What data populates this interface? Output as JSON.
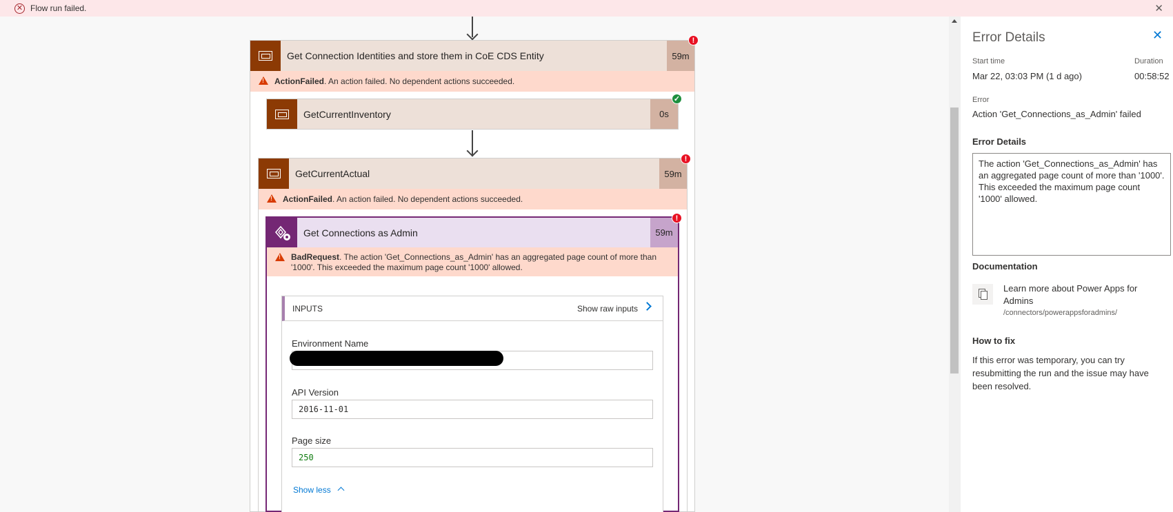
{
  "banner": {
    "message": "Flow run failed."
  },
  "flow": {
    "scope1": {
      "title": "Get Connection Identities and store them in CoE CDS Entity",
      "duration": "59m",
      "error_type": "ActionFailed",
      "error_msg": ". An action failed. No dependent actions succeeded."
    },
    "step_inventory": {
      "title": "GetCurrentInventory",
      "duration": "0s"
    },
    "scope2": {
      "title": "GetCurrentActual",
      "duration": "59m",
      "error_type": "ActionFailed",
      "error_msg": ". An action failed. No dependent actions succeeded."
    },
    "admin_action": {
      "title": "Get Connections as Admin",
      "duration": "59m",
      "error_type": "BadRequest",
      "error_line1": ". The action 'Get_Connections_as_Admin' has an aggregated page count of more than",
      "error_line2": "'1000'. This exceeded the maximum page count '1000' allowed.",
      "inputs_label": "INPUTS",
      "show_raw": "Show raw inputs",
      "fields": [
        {
          "label": "Environment Name",
          "value": ""
        },
        {
          "label": "API Version",
          "value": "2016-11-01"
        },
        {
          "label": "Page size",
          "value": "250"
        }
      ],
      "show_less": "Show less"
    }
  },
  "panel": {
    "title": "Error Details",
    "start_label": "Start time",
    "start_value": "Mar 22, 03:03 PM (1 d ago)",
    "duration_label": "Duration",
    "duration_value": "00:58:52",
    "error_label": "Error",
    "error_value": "Action 'Get_Connections_as_Admin' failed",
    "details_label": "Error Details",
    "details_text": "The action 'Get_Connections_as_Admin' has an aggregated page count of more than '1000'. This exceeded the maximum page count '1000' allowed.",
    "doc_label": "Documentation",
    "doc_link_line1": "Learn more about Power Apps for",
    "doc_link_line2": "Admins",
    "doc_path": "/connectors/powerappsforadmins/",
    "fix_label": "How to fix",
    "fix_line1": "If this error was temporary, you can try",
    "fix_line2": "resubmitting the run and the issue may have",
    "fix_line3": "been resolved."
  },
  "colors": {
    "scope_icon": "#8c3a04",
    "connector_icon": "#742774",
    "error_banner": "#fde7e9",
    "error_bar": "#fed9cc",
    "link": "#0078d4"
  }
}
